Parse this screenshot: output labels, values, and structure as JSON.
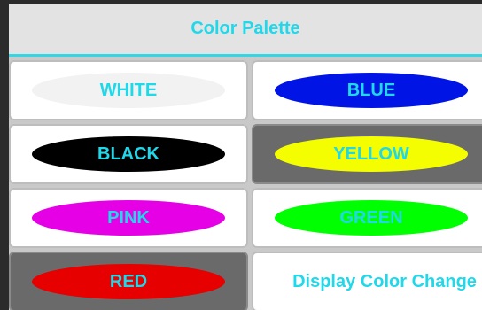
{
  "header": {
    "title": "Color Palette"
  },
  "colors": [
    {
      "label": "WHITE",
      "fill": "#f2f2f2",
      "selected": false
    },
    {
      "label": "BLUE",
      "fill": "#0014e6",
      "selected": false
    },
    {
      "label": "BLACK",
      "fill": "#000000",
      "selected": false
    },
    {
      "label": "YELLOW",
      "fill": "#f4fe00",
      "selected": true
    },
    {
      "label": "PINK",
      "fill": "#e600e6",
      "selected": false
    },
    {
      "label": "GREEN",
      "fill": "#00ff00",
      "selected": false
    },
    {
      "label": "RED",
      "fill": "#e60000",
      "selected": true
    }
  ],
  "action": {
    "label": "Display Color Change"
  },
  "accent_color": "#1fd8ea"
}
